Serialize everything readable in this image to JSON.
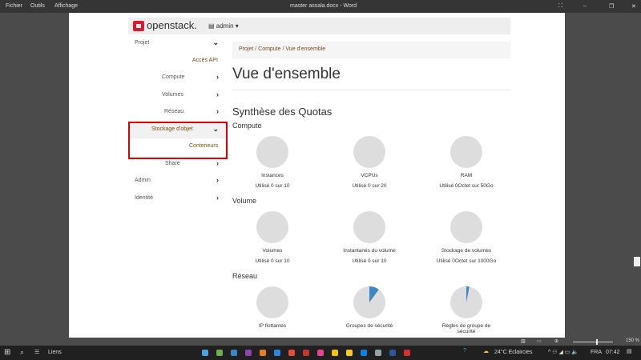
{
  "word": {
    "menu": [
      "Fichier",
      "Outils",
      "Affichage"
    ],
    "title": "master assala.docx  -  Word",
    "zoom": "150 %"
  },
  "taskbar": {
    "search": "Liens",
    "weather": "24°C  Eclaircies",
    "lang": "FRA",
    "time": "07:42"
  },
  "openstack": {
    "logo": "openstack.",
    "project": "admin",
    "sidebar": [
      {
        "label": "Projet",
        "chev": "⌄",
        "level": 0
      },
      {
        "label": "Accès API",
        "chev": "",
        "level": 2
      },
      {
        "label": "Compute",
        "chev": "›",
        "level": 1
      },
      {
        "label": "Volumes",
        "chev": "›",
        "level": 1
      },
      {
        "label": "Réseau",
        "chev": "›",
        "level": 1
      },
      {
        "label": "Stockage d'objet",
        "chev": "⌄",
        "level": 1,
        "active": true
      },
      {
        "label": "Conteneurs",
        "chev": "",
        "level": 2
      },
      {
        "label": "Share",
        "chev": "›",
        "level": 1
      },
      {
        "label": "Admin",
        "chev": "›",
        "level": 0
      },
      {
        "label": "Identité",
        "chev": "›",
        "level": 0
      }
    ],
    "breadcrumb": [
      "Projet",
      "Compute",
      "Vue d'ensemble"
    ],
    "title": "Vue d'ensemble",
    "quota_title": "Synthèse des Quotas",
    "sections": [
      {
        "name": "Compute",
        "items": [
          {
            "label": "Instances",
            "usage": "Utilisé 0 sur 10",
            "fraction": 0
          },
          {
            "label": "VCPUs",
            "usage": "Utilisé 0 sur 20",
            "fraction": 0
          },
          {
            "label": "RAM",
            "usage": "Utilisé 0Octet sur 50Go",
            "fraction": 0
          }
        ]
      },
      {
        "name": "Volume",
        "items": [
          {
            "label": "Volumes",
            "usage": "Utilisé 0 sur 10",
            "fraction": 0
          },
          {
            "label": "Instantanés du volume",
            "usage": "Utilisé 0 sur 10",
            "fraction": 0
          },
          {
            "label": "Stockage de volumes",
            "usage": "Utilisé 0Octet sur 1000Go",
            "fraction": 0
          }
        ]
      },
      {
        "name": "Réseau",
        "items": [
          {
            "label": "IP flottantes",
            "usage": "",
            "fraction": 0
          },
          {
            "label": "Groupes de sécurité",
            "usage": "",
            "fraction": 0.1
          },
          {
            "label": "Règles de groupe de sécurité",
            "usage": "",
            "fraction": 0.03
          }
        ]
      }
    ],
    "colors": {
      "pie_empty": "#dddddd",
      "pie_used": "#3d85c6",
      "highlight": "#e00000",
      "logo": "#da1a32"
    }
  }
}
